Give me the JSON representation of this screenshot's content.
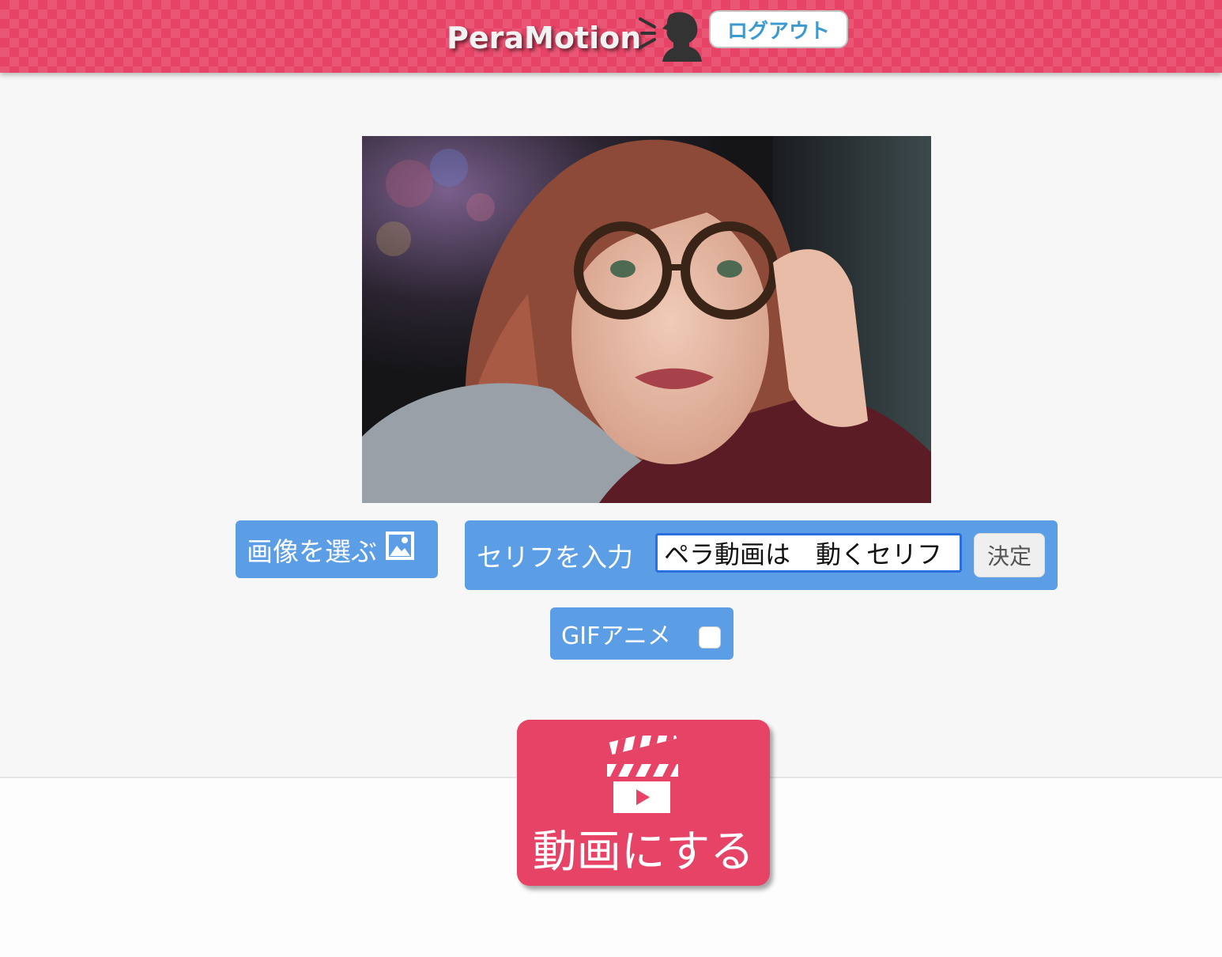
{
  "header": {
    "logo_text": "PeraMotion",
    "logo_icon": "speaking-person-icon",
    "logout_label": "ログアウト"
  },
  "main": {
    "preview_image": "woman-with-glasses-photo",
    "choose_image": {
      "label": "画像を選ぶ",
      "icon": "image-icon"
    },
    "serif": {
      "label": "セリフを入力",
      "input_value": "ペラ動画は　動くセリフ",
      "decide_label": "決定"
    },
    "gif": {
      "label": "GIFアニメ",
      "checked": false
    },
    "make_video": {
      "label": "動画にする",
      "icon": "clapperboard-icon"
    }
  },
  "colors": {
    "brand": "#e64366",
    "accent_blue": "#5b9ee6",
    "logout_text": "#3d9ad1"
  }
}
